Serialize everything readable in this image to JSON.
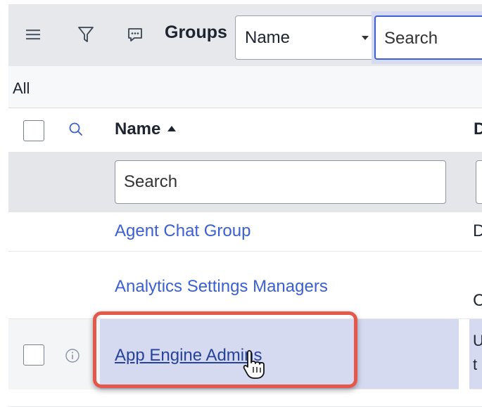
{
  "toolbar": {
    "title": "Groups",
    "field_select_value": "Name",
    "search_placeholder": "Search",
    "icons": [
      "menu-icon",
      "filter-icon",
      "chat-icon"
    ]
  },
  "breadcrumb": {
    "label": "All"
  },
  "table": {
    "columns": [
      {
        "label": "Name",
        "sort": "ascending"
      },
      {
        "label": "D"
      }
    ],
    "column_search_placeholder": "Search",
    "rows": [
      {
        "name": "Agent Chat Group",
        "col2": "D"
      },
      {
        "name": "Analytics Settings Managers",
        "col2": "C"
      },
      {
        "name": "App Engine Admins",
        "col2_line1": "U",
        "col2_line2": "t"
      }
    ]
  },
  "colors": {
    "accent": "#3f5ed6",
    "link": "#3b5fd4",
    "highlight_border": "#e5574a",
    "selected_row": "#d6daf0"
  }
}
